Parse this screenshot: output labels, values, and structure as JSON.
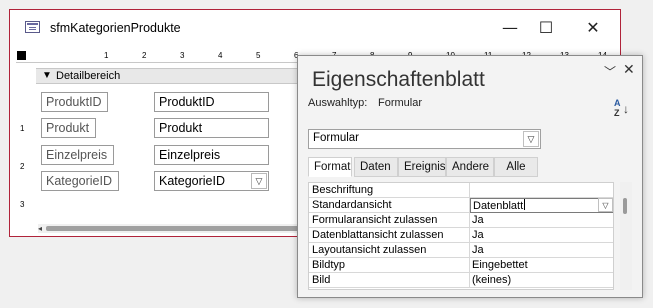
{
  "form_window": {
    "title": "sfmKategorienProdukte",
    "minimize_glyph": "—",
    "maximize_glyph": "☐",
    "close_glyph": "✕",
    "border_color": "#b0233a",
    "ruler_marks": [
      "1",
      "2",
      "3",
      "4",
      "5",
      "6",
      "7",
      "8",
      "9",
      "10",
      "11",
      "12",
      "13",
      "14"
    ],
    "left_ruler_marks": [
      "1",
      "2",
      "3"
    ],
    "section_label": "Detailbereich",
    "section_arrow": "▼",
    "fields": [
      {
        "label": "ProduktID",
        "control": "ProduktID"
      },
      {
        "label": "Produkt",
        "control": "Produkt"
      },
      {
        "label": "Einzelpreis",
        "control": "Einzelpreis"
      },
      {
        "label": "KategorieID",
        "control": "KategorieID"
      }
    ]
  },
  "property_sheet": {
    "title": "Eigenschaftenblatt",
    "selection_type_label": "Auswahltyp:",
    "selection_type_value": "Formular",
    "object_dropdown_value": "Formular",
    "tabs": [
      {
        "label": "Format",
        "active": true
      },
      {
        "label": "Daten",
        "active": false
      },
      {
        "label": "Ereignis",
        "active": false
      },
      {
        "label": "Andere",
        "active": false
      },
      {
        "label": "Alle",
        "active": false
      }
    ],
    "properties": [
      {
        "name": "Beschriftung",
        "value": ""
      },
      {
        "name": "Standardansicht",
        "value": "Datenblatt"
      },
      {
        "name": "Formularansicht zulassen",
        "value": "Ja"
      },
      {
        "name": "Datenblattansicht zulassen",
        "value": "Ja"
      },
      {
        "name": "Layoutansicht zulassen",
        "value": "Ja"
      },
      {
        "name": "Bildtyp",
        "value": "Eingebettet"
      },
      {
        "name": "Bild",
        "value": "(keines)"
      }
    ]
  }
}
